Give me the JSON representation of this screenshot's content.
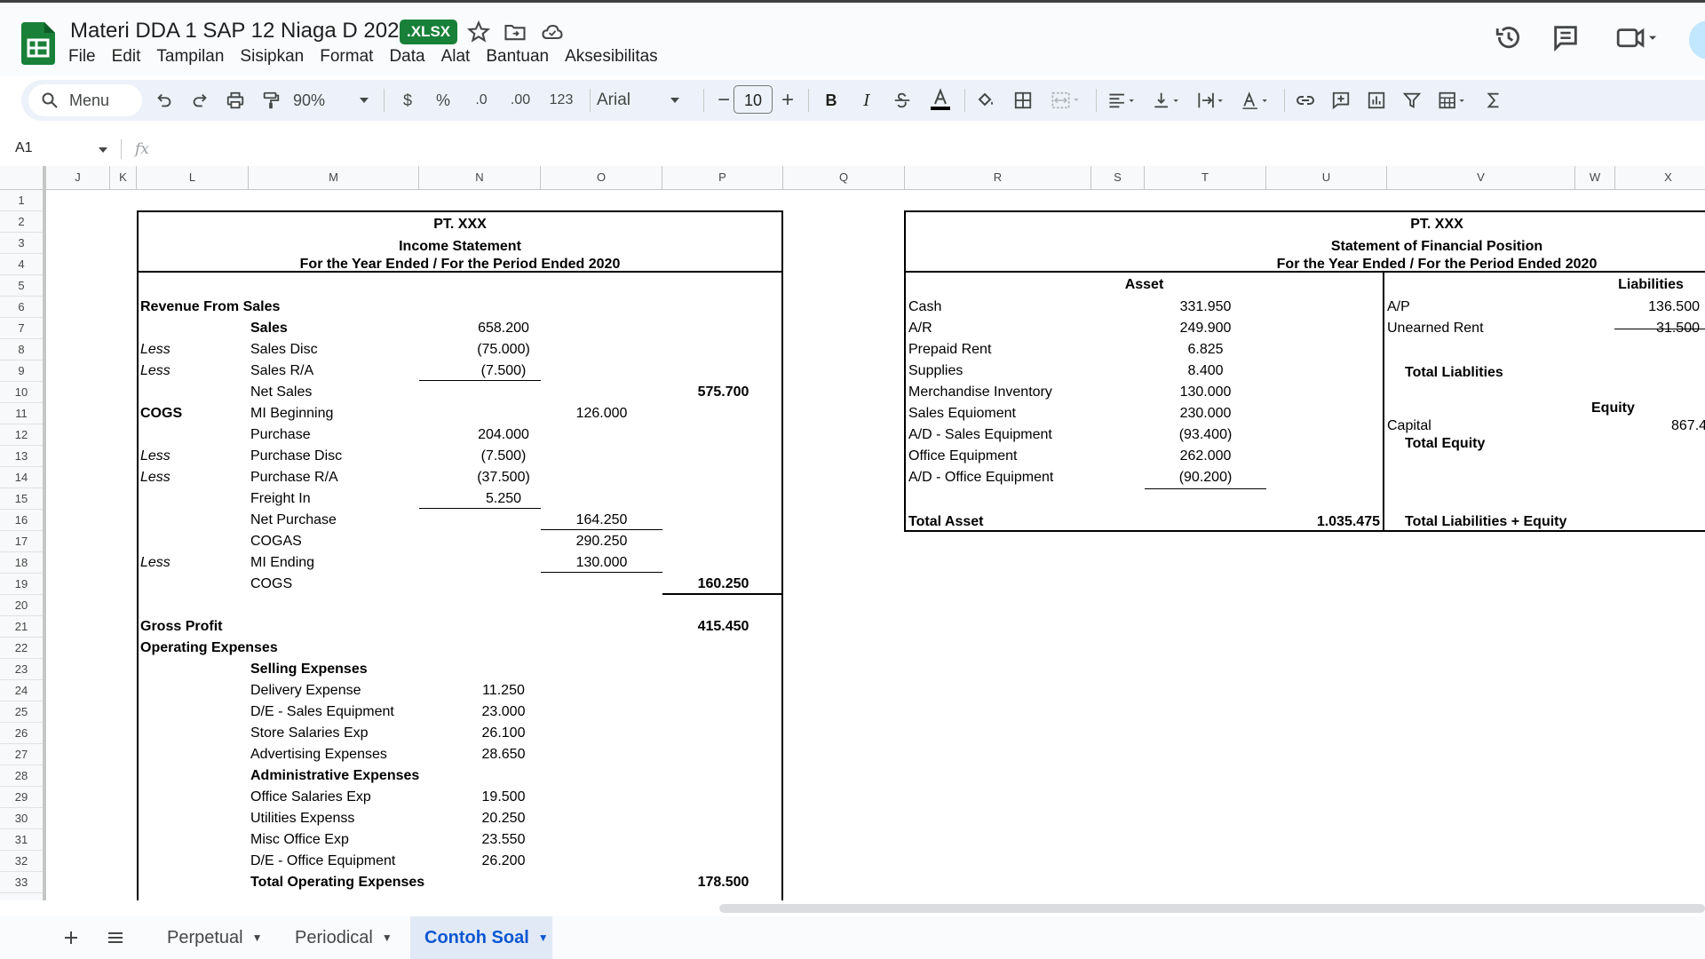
{
  "app": {
    "doc_title": "Materi DDA 1 SAP 12 Niaga D 2024",
    "file_badge": ".XLSX",
    "menu": [
      "File",
      "Edit",
      "Tampilan",
      "Sisipkan",
      "Format",
      "Data",
      "Alat",
      "Bantuan",
      "Aksesibilitas"
    ]
  },
  "toolbar": {
    "search_label": "Menu",
    "zoom": "90%",
    "currency": "$",
    "percent": "%",
    "dec_decrease": ".0",
    "dec_increase": ".00",
    "number_format": "123",
    "font": "Arial",
    "font_size": "10",
    "minus": "−",
    "plus": "+",
    "bold": "B",
    "italic": "I"
  },
  "formula_bar": {
    "cell_ref": "A1",
    "fx": "fx"
  },
  "columns": [
    "J",
    "K",
    "L",
    "M",
    "N",
    "O",
    "P",
    "Q",
    "R",
    "S",
    "T",
    "U",
    "V",
    "W",
    "X"
  ],
  "rows": [
    "1",
    "2",
    "3",
    "4",
    "5",
    "6",
    "7",
    "8",
    "9",
    "10",
    "11",
    "12",
    "13",
    "14",
    "15",
    "16",
    "17",
    "18",
    "19",
    "20",
    "21",
    "22",
    "23",
    "24",
    "25",
    "26",
    "27",
    "28",
    "29",
    "30",
    "31",
    "32",
    "33"
  ],
  "income_statement": {
    "company": "PT. XXX",
    "title": "Income Statement",
    "period": "For the Year Ended / For the Period Ended 2020",
    "lines": [
      {
        "l": "Revenue From Sales",
        "l_style": "b",
        "m": "",
        "n": "",
        "o": "",
        "p": ""
      },
      {
        "l": "",
        "m": "Sales",
        "m_style": "b",
        "n": "658.200",
        "o": "",
        "p": ""
      },
      {
        "l": "Less",
        "l_style": "i",
        "m": "Sales Disc",
        "n": "(75.000)",
        "o": "",
        "p": ""
      },
      {
        "l": "Less",
        "l_style": "i",
        "m": "Sales R/A",
        "n": "(7.500)",
        "n_ul": true,
        "o": "",
        "p": ""
      },
      {
        "l": "",
        "m": "Net Sales",
        "n": "",
        "o": "",
        "p": "575.700",
        "p_style": "b"
      },
      {
        "l": "COGS",
        "l_style": "b",
        "m": "MI Beginning",
        "n": "",
        "o": "126.000",
        "p": ""
      },
      {
        "l": "",
        "m": "Purchase",
        "n": "204.000",
        "o": "",
        "p": ""
      },
      {
        "l": "Less",
        "l_style": "i",
        "m": "Purchase Disc",
        "n": "(7.500)",
        "o": "",
        "p": ""
      },
      {
        "l": "Less",
        "l_style": "i",
        "m": "Purchase R/A",
        "n": "(37.500)",
        "o": "",
        "p": ""
      },
      {
        "l": "",
        "m": "Freight In",
        "n": "5.250",
        "n_ul": true,
        "o": "",
        "p": ""
      },
      {
        "l": "",
        "m": "Net Purchase",
        "n": "",
        "o": "164.250",
        "o_ul": true,
        "p": ""
      },
      {
        "l": "",
        "m": "COGAS",
        "n": "",
        "o": "290.250",
        "p": ""
      },
      {
        "l": "Less",
        "l_style": "i",
        "m": "MI Ending",
        "n": "",
        "o": "130.000",
        "o_ul": true,
        "p": ""
      },
      {
        "l": "",
        "m": "COGS",
        "n": "",
        "o": "",
        "p": "160.250",
        "p_style": "b",
        "p_ul": true
      },
      {
        "l": "",
        "m": "",
        "n": "",
        "o": "",
        "p": ""
      },
      {
        "l": "Gross Profit",
        "l_style": "b",
        "m": "",
        "n": "",
        "o": "",
        "p": "415.450",
        "p_style": "b"
      },
      {
        "l": "Operating Expenses",
        "l_style": "b",
        "m": "",
        "n": "",
        "o": "",
        "p": ""
      },
      {
        "l": "",
        "m": "Selling Expenses",
        "m_style": "b",
        "n": "",
        "o": "",
        "p": ""
      },
      {
        "l": "",
        "m": "Delivery Expense",
        "n": "11.250",
        "o": "",
        "p": ""
      },
      {
        "l": "",
        "m": "D/E - Sales Equipment",
        "n": "23.000",
        "o": "",
        "p": ""
      },
      {
        "l": "",
        "m": "Store Salaries Exp",
        "n": "26.100",
        "o": "",
        "p": ""
      },
      {
        "l": "",
        "m": "Advertising Expenses",
        "n": "28.650",
        "o": "",
        "p": ""
      },
      {
        "l": "",
        "m": "Administrative Expenses",
        "m_style": "b",
        "n": "",
        "o": "",
        "p": ""
      },
      {
        "l": "",
        "m": "Office Salaries Exp",
        "n": "19.500",
        "o": "",
        "p": ""
      },
      {
        "l": "",
        "m": "Utilities Expenss",
        "n": "20.250",
        "o": "",
        "p": ""
      },
      {
        "l": "",
        "m": "Misc Office Exp",
        "n": "23.550",
        "o": "",
        "p": ""
      },
      {
        "l": "",
        "m": "D/E - Office Equipment",
        "n": "26.200",
        "o": "",
        "p": ""
      },
      {
        "l": "",
        "m": "Total Operating Expenses",
        "m_style": "b",
        "n": "",
        "o": "",
        "p": "178.500",
        "p_style": "b"
      }
    ]
  },
  "financial_position": {
    "company": "PT. XXX",
    "title": "Statement of Financial Position",
    "period": "For the Year Ended / For the Period Ended 2020",
    "asset_header": "Asset",
    "liabilities_header": "Liabilities",
    "assets": [
      {
        "name": "Cash",
        "value": "331.950"
      },
      {
        "name": "A/R",
        "value": "249.900"
      },
      {
        "name": "Prepaid Rent",
        "value": "6.825"
      },
      {
        "name": "Supplies",
        "value": "8.400"
      },
      {
        "name": "Merchandise Inventory",
        "value": "130.000"
      },
      {
        "name": "Sales Equioment",
        "value": "230.000"
      },
      {
        "name": "A/D - Sales Equipment",
        "value": "(93.400)"
      },
      {
        "name": "Office Equipment",
        "value": "262.000"
      },
      {
        "name": "A/D - Office Equipment",
        "value": "(90.200)"
      }
    ],
    "total_asset_label": "Total Asset",
    "total_asset_value": "1.035.475",
    "liabilities": [
      {
        "name": "A/P",
        "value": "136.500"
      },
      {
        "name": "Unearned Rent",
        "value": "31.500"
      }
    ],
    "total_liabilities_label": "Total Liablities",
    "equity_header": "Equity",
    "capital_label": "Capital",
    "capital_value": "867.4",
    "total_equity_label": "Total Equity",
    "total_le_label": "Total Liabilities + Equity"
  },
  "sheet_tabs": [
    {
      "label": "Perpetual",
      "active": false
    },
    {
      "label": "Periodical",
      "active": false
    },
    {
      "label": "Contoh Soal",
      "active": true
    }
  ],
  "colors": {
    "sheets_green": "#188038",
    "active_tab_blue": "#0b57d0",
    "toolbar_bg": "#edf2fa"
  }
}
